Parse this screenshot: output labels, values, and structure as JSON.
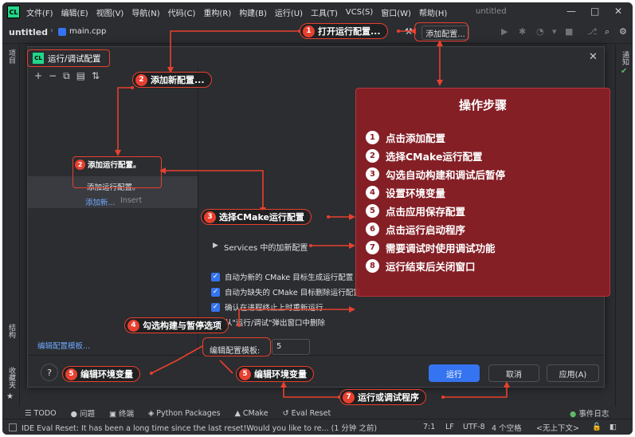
{
  "menubar": {
    "logo": "CL",
    "items": [
      "文件(F)",
      "编辑(E)",
      "视图(V)",
      "导航(N)",
      "代码(C)",
      "重构(R)",
      "构建(B)",
      "运行(U)",
      "工具(T)",
      "VCS(S)",
      "窗口(W)",
      "帮助(H)"
    ],
    "title": "untitled"
  },
  "toolbar": {
    "project": "untitled",
    "file": "main.cpp",
    "add_config_label": "添加配置..."
  },
  "left_sidebar": {
    "project_label": "项目",
    "structure_label": "结构",
    "bookmarks_label": "收藏夹"
  },
  "right_sidebar": {
    "notifications_label": "通知"
  },
  "dialog": {
    "title": "运行/调试配置",
    "tree_add_item": "添加运行配置。",
    "tree_new_item": "添加新...",
    "tree_insert_hint": "Insert",
    "services_label": "Services 中的加新配置",
    "checkboxes": [
      "自动为新的 CMake 目标生成运行配置",
      "自动为缺失的 CMake 目标删除运行配置",
      "确认在进程终止上时重新运行",
      "从\"运行/调试\"弹出窗口中删除"
    ],
    "edit_templates_link": "编辑配置模板...",
    "template_limit_label": "编辑配置模板:",
    "template_limit_value": "5",
    "run_button": "运行",
    "cancel_button": "取消",
    "apply_button": "应用(A)",
    "help": "?"
  },
  "bottom_tabs": [
    "TODO",
    "问题",
    "终端",
    "Python Packages",
    "CMake",
    "Eval Reset"
  ],
  "event_log": "事件日志",
  "statusbar": {
    "message": "IDE Eval Reset: It has been a long time since the last reset!Would you like to re... (1 分钟 之前)",
    "position": "7:1",
    "line_sep": "LF",
    "encoding": "UTF-8",
    "indent": "4 个空格",
    "context": "<无上下文>"
  },
  "callouts": {
    "c1": {
      "num": "1",
      "text": "打开运行配置..."
    },
    "c2": {
      "num": "2",
      "text": "添加新配置..."
    },
    "c2b": {
      "num": "2",
      "text": "添加运行配置。"
    },
    "c3": {
      "num": "3",
      "text": "选择CMake运行配置"
    },
    "c4": {
      "num": "4",
      "text": "勾选构建与暂停选项"
    },
    "c5a": {
      "num": "5",
      "text": "编辑环境变量"
    },
    "c5b": {
      "num": "5",
      "text": "编辑环境变量"
    },
    "c7": {
      "num": "7",
      "text": "运行或调试程序"
    }
  },
  "steps": {
    "title": "操作步骤",
    "items": [
      {
        "num": "1",
        "text": "点击添加配置"
      },
      {
        "num": "2",
        "text": "选择CMake运行配置"
      },
      {
        "num": "3",
        "text": "勾选自动构建和调试后暂停"
      },
      {
        "num": "4",
        "text": "设置环境变量"
      },
      {
        "num": "5",
        "text": "点击应用保存配置"
      },
      {
        "num": "6",
        "text": "点击运行启动程序"
      },
      {
        "num": "7",
        "text": "需要调试时使用调试功能"
      },
      {
        "num": "8",
        "text": "运行结束后关闭窗口"
      }
    ]
  },
  "colors": {
    "accent": "#e8402f",
    "primary_button": "#3574f0",
    "steps_panel": "#8c1e26",
    "background": "#2b2d30"
  }
}
